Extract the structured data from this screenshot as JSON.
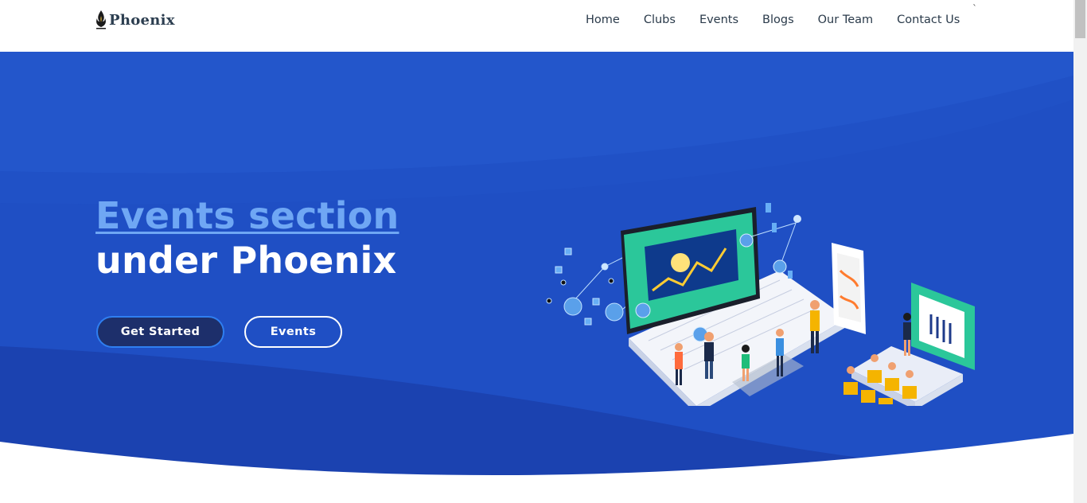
{
  "brand": {
    "name": "Phoenix"
  },
  "nav": {
    "items": [
      {
        "label": "Home"
      },
      {
        "label": "Clubs"
      },
      {
        "label": "Events"
      },
      {
        "label": "Blogs"
      },
      {
        "label": "Our Team"
      },
      {
        "label": "Contact Us"
      }
    ],
    "stray_mark": "`"
  },
  "hero": {
    "headline_link": "Events section",
    "headline_line2": "under Phoenix",
    "primary_button": "Get Started",
    "secondary_button": "Events",
    "illustration": "isometric-laptop-team-analytics-illustration"
  },
  "colors": {
    "hero_bg": "#1f4fc4",
    "hero_dark": "#1a3fae",
    "headline_link": "#6fa7f4",
    "primary_button_bg": "#1d2f6b",
    "primary_button_border": "#2f7ef0",
    "nav_text": "#2a3a4a"
  }
}
